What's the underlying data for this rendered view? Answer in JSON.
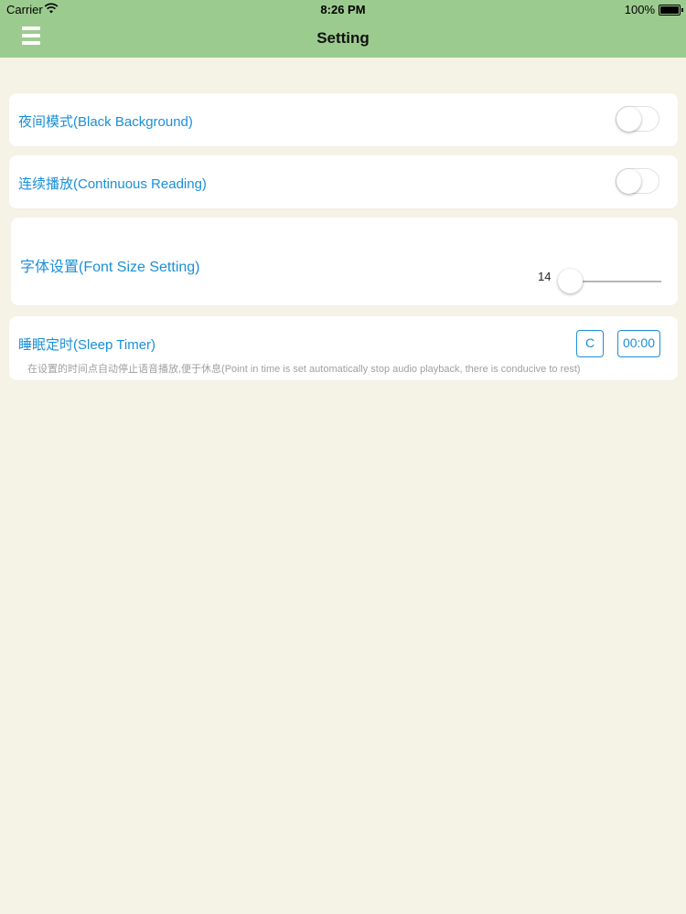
{
  "status_bar": {
    "carrier": "Carrier",
    "time": "8:26 PM",
    "battery": "100%"
  },
  "nav": {
    "title": "Setting",
    "menu_icon": "hamburger-menu-icon"
  },
  "settings": {
    "night_mode": {
      "label": "夜间模式(Black Background)",
      "enabled": false
    },
    "continuous": {
      "label": "连续播放(Continuous Reading)",
      "enabled": false
    },
    "font_size": {
      "label": "字体设置(Font Size Setting)",
      "value": "14"
    },
    "sleep_timer": {
      "label": "睡眠定时(Sleep Timer)",
      "clear_label": "C",
      "time_value": "00:00",
      "hint": "在设置的时间点自动停止语音播放,便于休息(Point in time is set automatically stop audio playback, there is conducive to rest)"
    }
  },
  "colors": {
    "bar": "#9ccb8f",
    "background": "#f5f2e6",
    "accent": "#1a8fd8"
  }
}
